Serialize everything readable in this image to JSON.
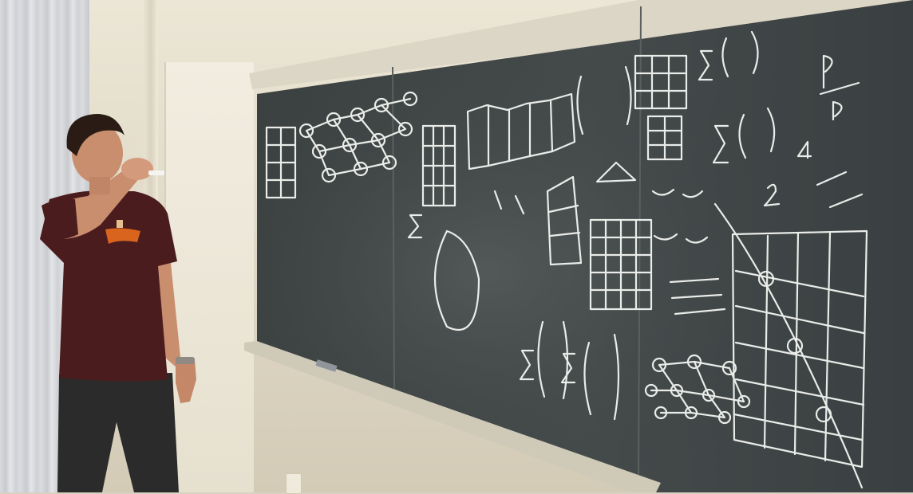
{
  "scene": {
    "description_tag": "",
    "colors": {
      "chalkboard": "#3a3f40",
      "chalk": "#e9ece8",
      "wall": "#e6e0cf",
      "shirt": "#4a1c1e",
      "shirt_print": "#d8641e",
      "pants": "#2b2b2b",
      "skin": "#c98e6e",
      "hair": "#2a1c14"
    },
    "icons": {
      "curtain": "curtain-icon",
      "door": "door-icon",
      "chalkboard": "chalkboard-icon",
      "person": "person-icon",
      "outlet": "outlet-icon"
    }
  }
}
